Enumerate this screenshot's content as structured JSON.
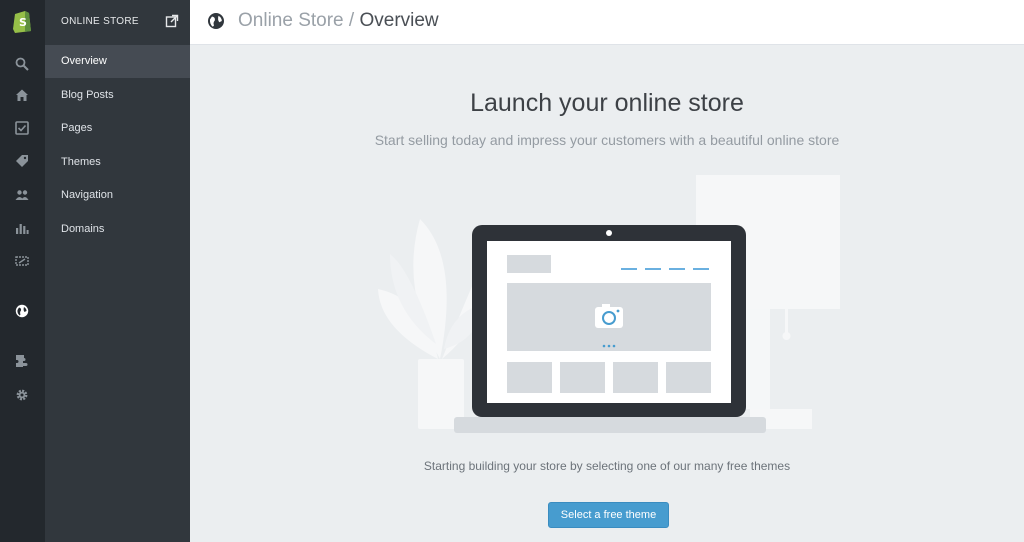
{
  "rail": {
    "items": [
      {
        "icon": "search-icon"
      },
      {
        "icon": "home-icon"
      },
      {
        "icon": "orders-icon"
      },
      {
        "icon": "tag-icon"
      },
      {
        "icon": "customers-icon"
      },
      {
        "icon": "reports-icon"
      },
      {
        "icon": "discounts-icon"
      },
      {
        "icon": "globe-icon"
      },
      {
        "icon": "apps-icon"
      },
      {
        "icon": "settings-icon"
      }
    ]
  },
  "sidebar": {
    "title": "ONLINE STORE",
    "items": [
      {
        "label": "Overview",
        "active": true
      },
      {
        "label": "Blog Posts"
      },
      {
        "label": "Pages"
      },
      {
        "label": "Themes"
      },
      {
        "label": "Navigation"
      },
      {
        "label": "Domains"
      }
    ]
  },
  "header": {
    "section": "Online Store",
    "separator": " / ",
    "page": "Overview"
  },
  "main": {
    "headline": "Launch your online store",
    "subheadline": "Start selling today and impress your customers with a beautiful online store",
    "hint": "Starting building your store by selecting one of our many free themes",
    "cta": "Select a free theme"
  },
  "colors": {
    "accent": "#479ccf",
    "brand_green": "#96bf48",
    "rail_bg": "#23282d",
    "sidebar_bg": "#31373d"
  }
}
